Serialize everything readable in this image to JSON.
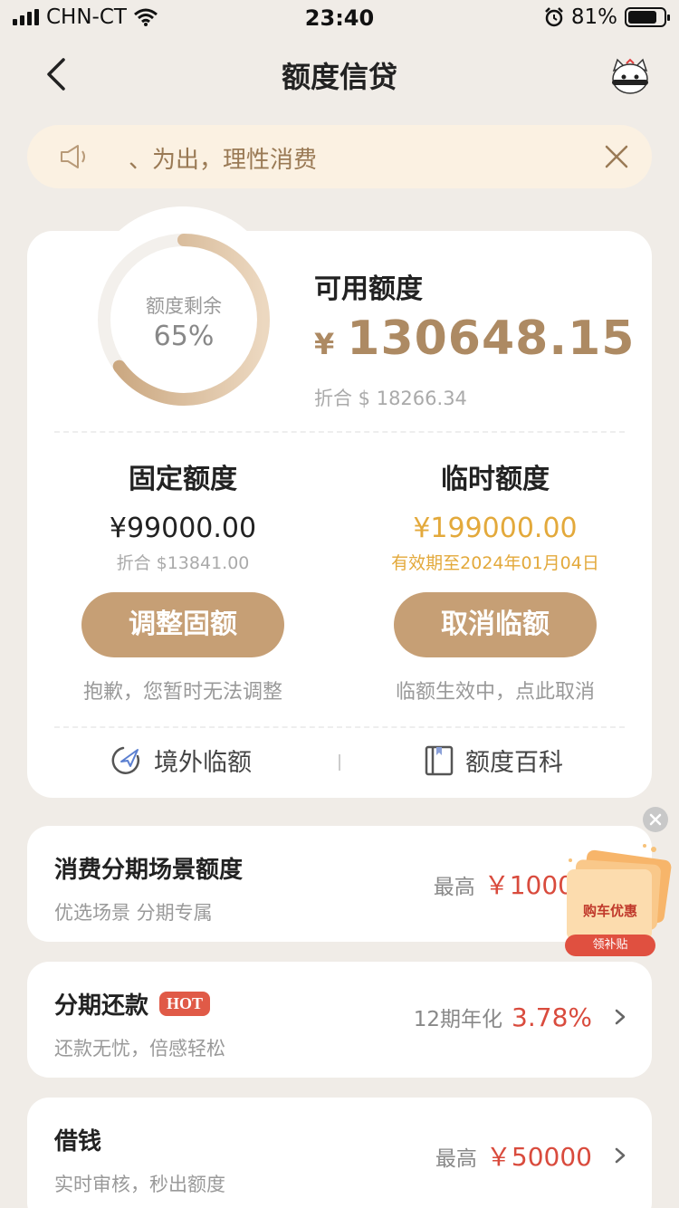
{
  "status_bar": {
    "carrier": "CHN-CT",
    "time": "23:40",
    "battery": "81%",
    "battery_level": 0.81
  },
  "nav": {
    "title": "额度信贷"
  },
  "notice": {
    "text": "、为出，理性消费"
  },
  "quota": {
    "remaining_label": "额度剩余",
    "remaining_percent_text": "65%",
    "remaining_fraction": 0.65,
    "available_title": "可用额度",
    "currency_symbol": "¥",
    "available_amount": "130648.15",
    "available_converted": "折合 $ 18266.34"
  },
  "fixed": {
    "title": "固定额度",
    "amount": "¥99000.00",
    "converted": "折合 $13841.00",
    "button": "调整固额",
    "note": "抱歉，您暂时无法调整"
  },
  "temporary": {
    "title": "临时额度",
    "amount": "¥199000.00",
    "expiry": "有效期至2024年01月04日",
    "button": "取消临额",
    "note": "临额生效中，点此取消"
  },
  "links": {
    "overseas": "境外临额",
    "encyclopedia": "额度百科"
  },
  "list": [
    {
      "title": "消费分期场景额度",
      "subtitle": "优选场景 分期专属",
      "label": "最高",
      "value": "￥1000"
    },
    {
      "title": "分期还款",
      "badge": "HOT",
      "subtitle": "还款无忧，倍感轻松",
      "label": "12期年化",
      "value": "3.78%"
    },
    {
      "title": "借钱",
      "subtitle": "实时审核，秒出额度",
      "label": "最高",
      "value": "￥50000"
    }
  ],
  "promo": {
    "text": "购车优惠",
    "button": "领补贴"
  },
  "colors": {
    "accent": "#c69f75",
    "gold_text": "#ad8a63",
    "temp_amount": "#e3a93b",
    "red": "#d94b3d"
  }
}
